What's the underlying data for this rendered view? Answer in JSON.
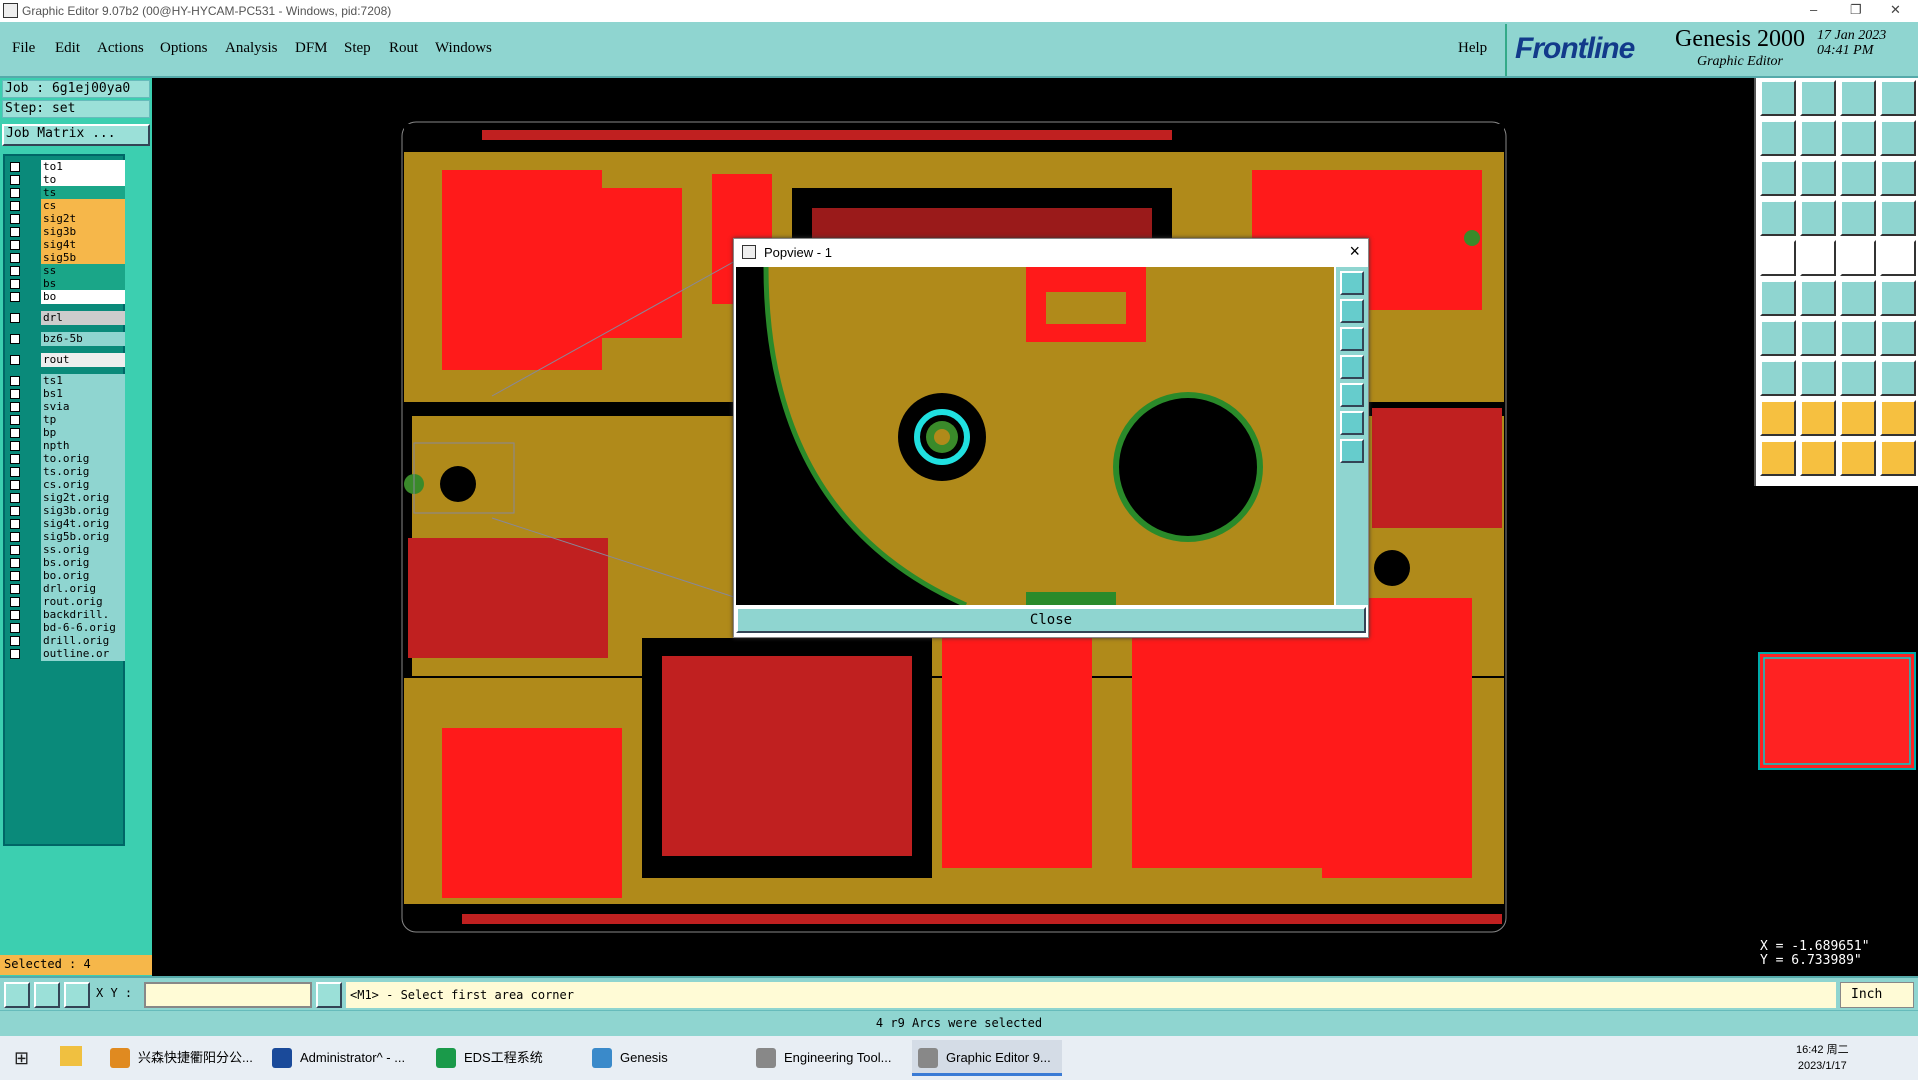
{
  "window": {
    "title": "Graphic Editor 9.07b2 (00@HY-HYCAM-PC531 - Windows, pid:7208)"
  },
  "menu": {
    "items": [
      "File",
      "Edit",
      "Actions",
      "Options",
      "Analysis",
      "DFM",
      "Step",
      "Rout",
      "Windows"
    ],
    "help": "Help"
  },
  "brand": {
    "logo": "Frontline",
    "product": "Genesis 2000",
    "subtitle": "Graphic Editor",
    "date": "17 Jan 2023",
    "time": "04:41 PM"
  },
  "job": {
    "job_label": "Job : 6g1ej00ya0",
    "step_label": "Step: set",
    "matrix_button": "Job Matrix ..."
  },
  "layers": [
    {
      "name": "to1",
      "color": "#ffffff"
    },
    {
      "name": "to",
      "color": "#ffffff"
    },
    {
      "name": "ts",
      "color": "#1aa688"
    },
    {
      "name": "cs",
      "color": "#f6b74a"
    },
    {
      "name": "sig2t",
      "color": "#f6b74a"
    },
    {
      "name": "sig3b",
      "color": "#f6b74a"
    },
    {
      "name": "sig4t",
      "color": "#f6b74a"
    },
    {
      "name": "sig5b",
      "color": "#f6b74a"
    },
    {
      "name": "ss",
      "color": "#1aa688"
    },
    {
      "name": "bs",
      "color": "#1aa688"
    },
    {
      "name": "bo",
      "color": "#ffffff"
    },
    {
      "name": "drl",
      "color": "#cccccc"
    },
    {
      "name": "bz6-5b",
      "color": "#8fd5d0"
    },
    {
      "name": "rout",
      "color": "#eeeeee"
    },
    {
      "name": "ts1",
      "color": "#8fd5d0"
    },
    {
      "name": "bs1",
      "color": "#8fd5d0"
    },
    {
      "name": "svia",
      "color": "#8fd5d0"
    },
    {
      "name": "tp",
      "color": "#8fd5d0"
    },
    {
      "name": "bp",
      "color": "#8fd5d0"
    },
    {
      "name": "npth",
      "color": "#8fd5d0"
    },
    {
      "name": "to.orig",
      "color": "#8fd5d0"
    },
    {
      "name": "ts.orig",
      "color": "#8fd5d0"
    },
    {
      "name": "cs.orig",
      "color": "#8fd5d0"
    },
    {
      "name": "sig2t.orig",
      "color": "#8fd5d0"
    },
    {
      "name": "sig3b.orig",
      "color": "#8fd5d0"
    },
    {
      "name": "sig4t.orig",
      "color": "#8fd5d0"
    },
    {
      "name": "sig5b.orig",
      "color": "#8fd5d0"
    },
    {
      "name": "ss.orig",
      "color": "#8fd5d0"
    },
    {
      "name": "bs.orig",
      "color": "#8fd5d0"
    },
    {
      "name": "bo.orig",
      "color": "#8fd5d0"
    },
    {
      "name": "drl.orig",
      "color": "#8fd5d0"
    },
    {
      "name": "rout.orig",
      "color": "#8fd5d0"
    },
    {
      "name": "backdrill.",
      "color": "#8fd5d0"
    },
    {
      "name": "bd-6-6.orig",
      "color": "#8fd5d0"
    },
    {
      "name": "drill.orig",
      "color": "#8fd5d0"
    },
    {
      "name": "outline.or",
      "color": "#8fd5d0"
    }
  ],
  "selected": "Selected : 4",
  "popup": {
    "title": "Popview - 1",
    "close": "Close"
  },
  "coords": {
    "x": "X = -1.689651\"",
    "y": "Y =  6.733989\""
  },
  "status": {
    "xy_label": "X Y :",
    "prompt": "<M1> - Select first area corner",
    "unit": "Inch"
  },
  "message": "4 r9 Arcs were selected",
  "taskbar": {
    "items": [
      "兴森快捷衢阳分公...",
      "Administrator^ - ...",
      "EDS工程系统",
      "Genesis",
      "Engineering Tool...",
      "Graphic Editor 9..."
    ],
    "time": "16:42 周二",
    "date": "2023/1/17"
  }
}
